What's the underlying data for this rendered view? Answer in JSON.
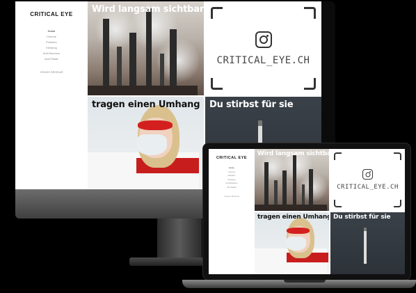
{
  "site": {
    "brand": "CRITICAL EYE",
    "menu": [
      "Home",
      "Chemie",
      "Pollution",
      "Kleidung",
      "Anti-Rauchen",
      "Anti-Plastic"
    ],
    "contact": "Unsere Mensuel"
  },
  "tiles": {
    "factory_caption": "Wird langsam sichtbar",
    "instagram_handle": "CRITICAL_EYE.CH",
    "nurse_caption": "tragen einen Umhang",
    "dark_caption": "Du stirbst für sie"
  },
  "colors": {
    "caption_light": "#ffffff",
    "caption_dark": "#111111",
    "accent_red": "#d3201f"
  },
  "icons": {
    "instagram": "instagram-icon"
  }
}
